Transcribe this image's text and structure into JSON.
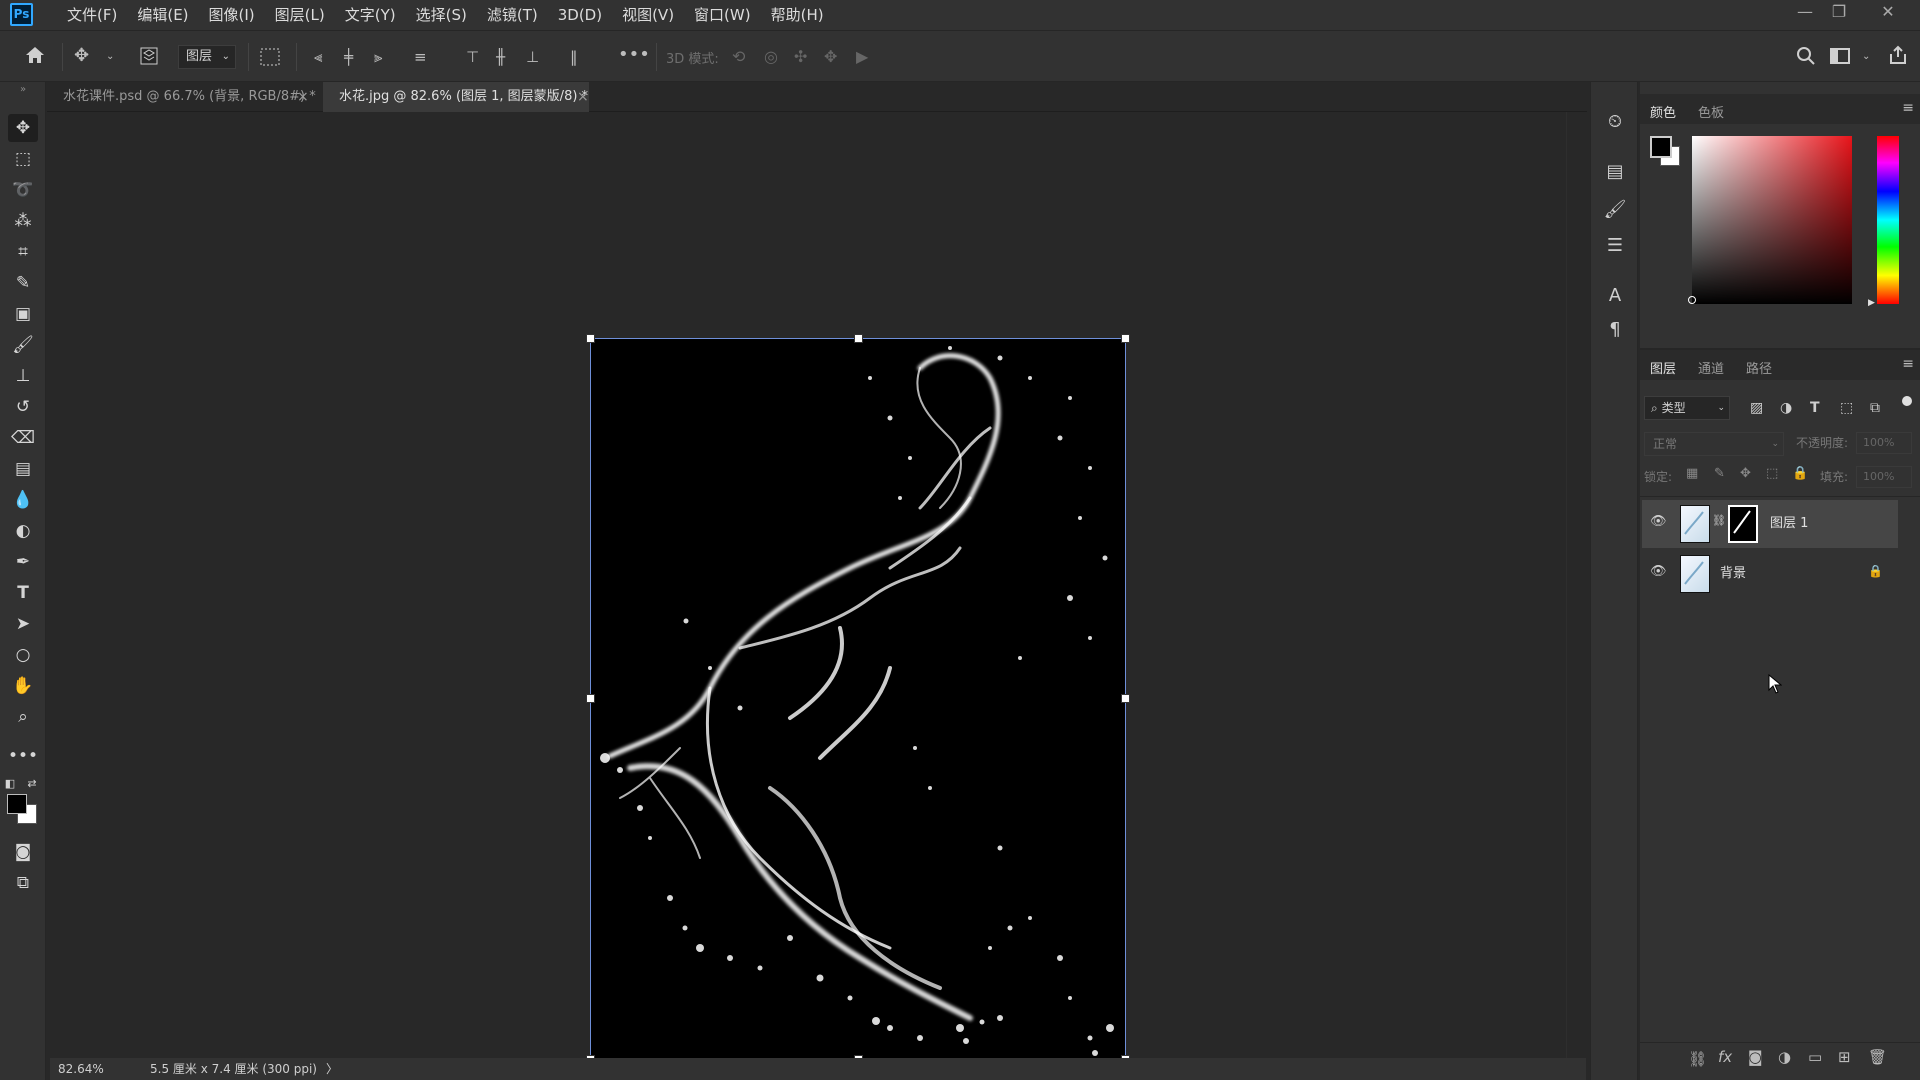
{
  "app": {
    "logo": "Ps"
  },
  "menu": [
    "文件(F)",
    "编辑(E)",
    "图像(I)",
    "图层(L)",
    "文字(Y)",
    "选择(S)",
    "滤镜(T)",
    "3D(D)",
    "视图(V)",
    "窗口(W)",
    "帮助(H)"
  ],
  "options": {
    "target_value": "图层",
    "mode_3d_label": "3D 模式:"
  },
  "tabs": [
    {
      "label": "水花课件.psd @ 66.7% (背景, RGB/8#) *",
      "close": "×"
    },
    {
      "label": "水花.jpg @ 82.6% (图层 1, 图层蒙版/8) *",
      "close": "×"
    }
  ],
  "status": {
    "zoom": "82.64%",
    "doc_size": "5.5 厘米 x 7.4 厘米 (300 ppi)",
    "arrow": "〉"
  },
  "color_panel": {
    "tabs": [
      "颜色",
      "色板"
    ],
    "foreground": "#000000",
    "background": "#ffffff"
  },
  "layers_panel": {
    "tabs": [
      "图层",
      "通道",
      "路径"
    ],
    "filter_label": "类型",
    "blend_mode": "正常",
    "opacity_label": "不透明度:",
    "opacity_value": "100%",
    "lock_label": "锁定:",
    "fill_label": "填充:",
    "fill_value": "100%",
    "layers": [
      {
        "name": "图层 1",
        "selected": true,
        "has_mask": true
      },
      {
        "name": "背景",
        "selected": false,
        "locked": true
      }
    ]
  },
  "colors": {
    "accent": "#31a8ff",
    "bbox": "#6e8fd9"
  }
}
